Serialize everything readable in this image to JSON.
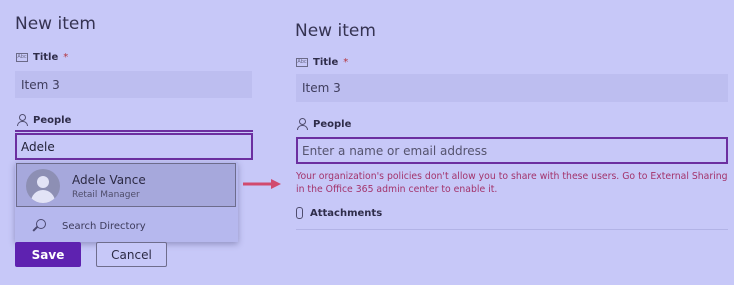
{
  "left": {
    "title": "New item",
    "title_field": {
      "label": "Title",
      "required_mark": "*",
      "value": "Item 3"
    },
    "people_field": {
      "label": "People",
      "value": "Adele"
    },
    "suggestion": {
      "name": "Adele Vance",
      "role": "Retail Manager"
    },
    "search_directory": "Search Directory",
    "save_label": "Save",
    "cancel_label": "Cancel"
  },
  "right": {
    "title": "New item",
    "title_field": {
      "label": "Title",
      "required_mark": "*",
      "value": "Item 3"
    },
    "people_field": {
      "label": "People",
      "placeholder": "Enter a name or email address"
    },
    "error": "Your organization's policies don't allow you to share with these users. Go to External Sharing in the Office 365 admin center to enable it.",
    "attachments_label": "Attachments"
  },
  "colors": {
    "background": "#c7c8f8",
    "accent": "#6c2fa0",
    "save_button": "#5e22b0",
    "error_text": "#a3336b",
    "arrow": "#d14a6e"
  }
}
